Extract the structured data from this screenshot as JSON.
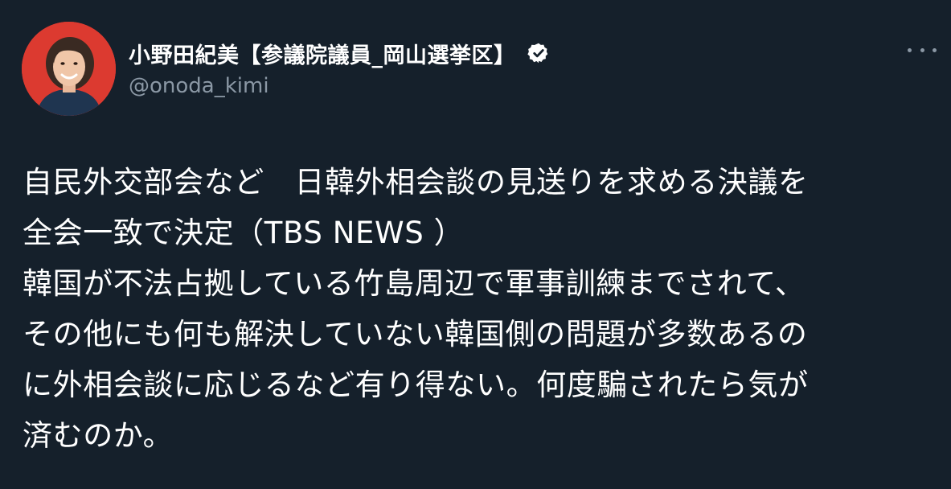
{
  "author": {
    "display_name": "小野田紀美【参議院議員_岡山選挙区】",
    "handle": "@onoda_kimi",
    "verified": true,
    "avatar_bg": "#dc3a30"
  },
  "actions": {
    "more_icon": "more-horizontal-icon"
  },
  "tweet": {
    "lines": [
      "自民外交部会など　日韓外相会談の見送りを求める決議を",
      "全会一致で決定（TBS NEWS ）",
      "韓国が不法占拠している竹島周辺で軍事訓練までされて、",
      "その他にも何も解決していない韓国側の問題が多数あるの",
      "に外相会談に応じるなど有り得ない。何度騙されたら気が",
      "済むのか。"
    ]
  },
  "colors": {
    "background": "#15202b",
    "text": "#ffffff",
    "muted": "#8b98a5"
  }
}
